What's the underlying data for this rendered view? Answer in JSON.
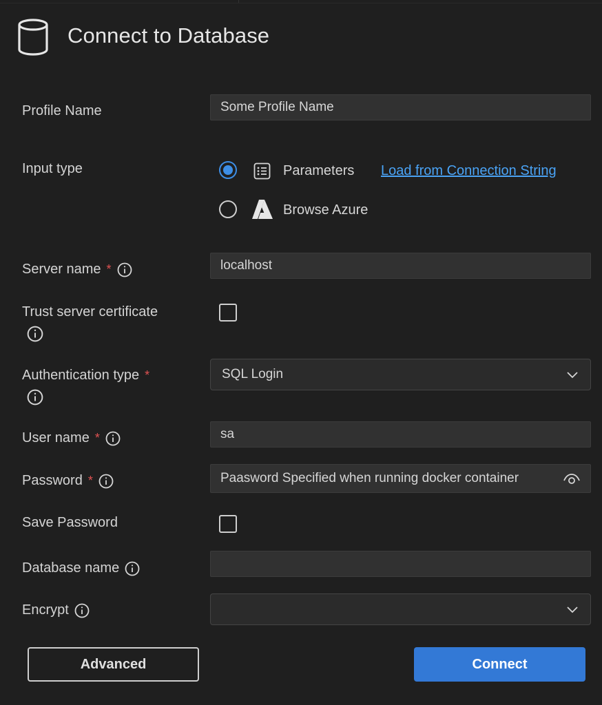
{
  "header": {
    "title": "Connect to Database",
    "icon": "database-icon"
  },
  "fields": {
    "profile_name": {
      "label": "Profile Name",
      "value": "Some Profile Name"
    },
    "input_type": {
      "label": "Input type",
      "options": [
        {
          "label": "Parameters",
          "selected": true,
          "icon": "list-form-icon"
        },
        {
          "label": "Browse Azure",
          "selected": false,
          "icon": "azure-logo-icon"
        }
      ],
      "link": "Load from Connection String"
    },
    "server_name": {
      "label": "Server name",
      "required": "*",
      "value": "localhost"
    },
    "trust_cert": {
      "label": "Trust server certificate",
      "checked": false
    },
    "auth_type": {
      "label": "Authentication type",
      "required": "*",
      "value": "SQL Login"
    },
    "user_name": {
      "label": "User name",
      "required": "*",
      "value": "sa"
    },
    "password": {
      "label": "Password",
      "required": "*",
      "value": "Paasword Specified when running docker container"
    },
    "save_password": {
      "label": "Save Password",
      "checked": false
    },
    "database_name": {
      "label": "Database name",
      "value": ""
    },
    "encrypt": {
      "label": "Encrypt",
      "value": ""
    }
  },
  "buttons": {
    "advanced": "Advanced",
    "connect": "Connect"
  },
  "colors": {
    "accent": "#3d8ee6",
    "link": "#4aa3f5",
    "required": "#e05252",
    "primary_button": "#3379d6"
  }
}
